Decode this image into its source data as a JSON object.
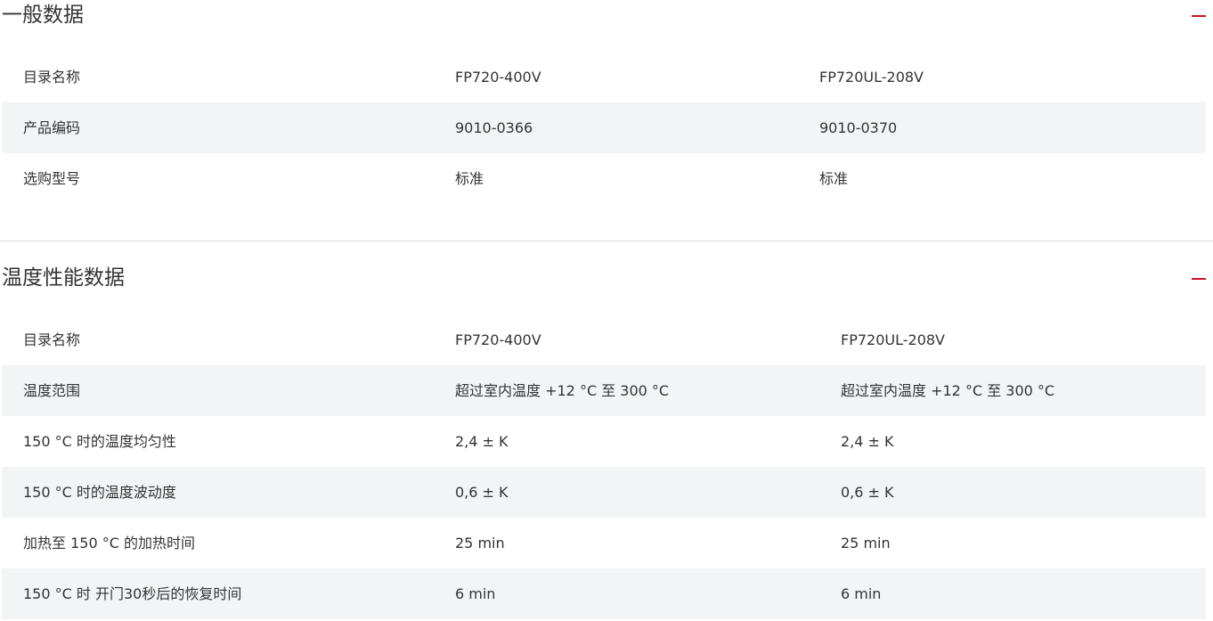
{
  "general": {
    "title": "一般数据",
    "rows": [
      {
        "label": "目录名称",
        "v1": "FP720-400V",
        "v2": "FP720UL-208V"
      },
      {
        "label": "产品编码",
        "v1": "9010-0366",
        "v2": "9010-0370"
      },
      {
        "label": "选购型号",
        "v1": "标准",
        "v2": "标准"
      }
    ]
  },
  "temperature": {
    "title": "温度性能数据",
    "rows": [
      {
        "label": "目录名称",
        "v1": "FP720-400V",
        "v2": "FP720UL-208V"
      },
      {
        "label": "温度范围",
        "v1": "超过室内温度 +12 °C 至 300 °C",
        "v2": "超过室内温度 +12 °C 至 300 °C"
      },
      {
        "label": "150 °C 时的温度均匀性",
        "v1": "2,4 ± K",
        "v2": "2,4 ± K"
      },
      {
        "label": "150 °C 时的温度波动度",
        "v1": "0,6 ± K",
        "v2": "0,6 ± K"
      },
      {
        "label": "加热至 150 °C 的加热时间",
        "v1": "25 min",
        "v2": "25 min"
      },
      {
        "label": "150 °C 时 开门30秒后的恢复时间",
        "v1": "6 min",
        "v2": "6 min"
      }
    ]
  },
  "colors": {
    "accent": "#c8102e",
    "row_alt": "#f3f4f6",
    "text": "#333333"
  },
  "icons": {
    "collapse": "minus-icon"
  }
}
